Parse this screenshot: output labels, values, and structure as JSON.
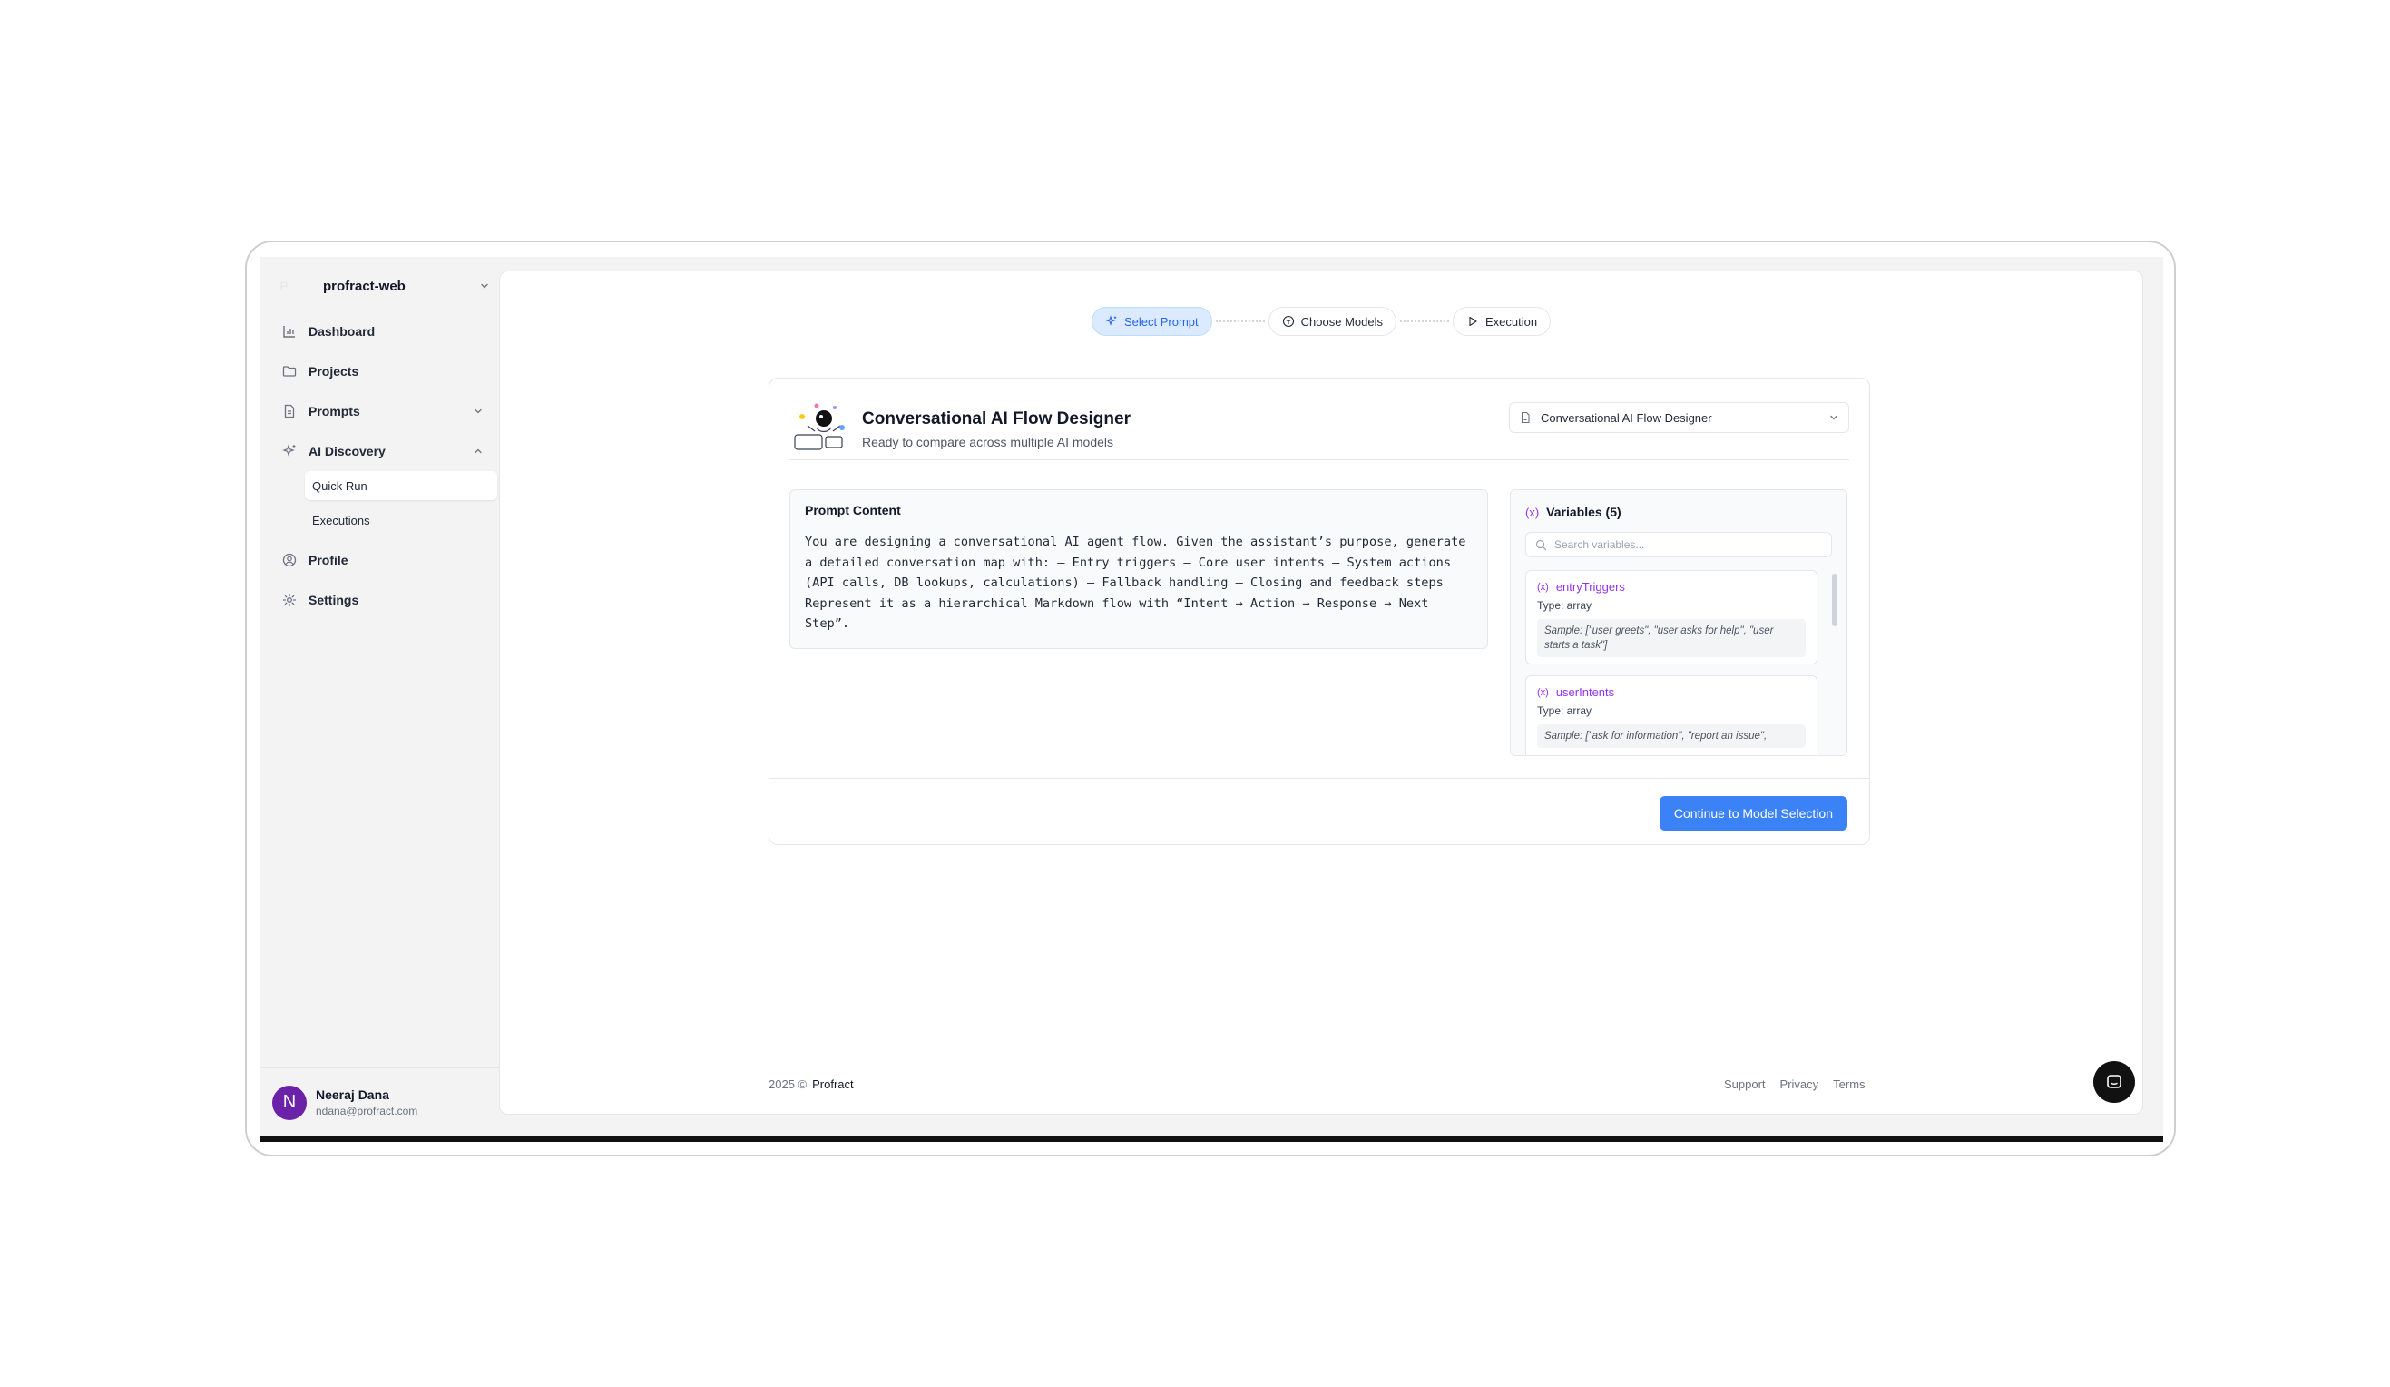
{
  "workspace": {
    "logo": "P",
    "name": "profract-web"
  },
  "nav": {
    "dashboard": "Dashboard",
    "projects": "Projects",
    "prompts": "Prompts",
    "ai_discovery": "AI Discovery",
    "quick_run": "Quick Run",
    "executions": "Executions",
    "profile": "Profile",
    "settings": "Settings"
  },
  "user": {
    "initial": "N",
    "name": "Neeraj Dana",
    "email": "ndana@profract.com"
  },
  "steps": [
    {
      "label": "Select Prompt",
      "state": "active"
    },
    {
      "label": "Choose Models",
      "state": "pending"
    },
    {
      "label": "Execution",
      "state": "pending"
    }
  ],
  "prompt": {
    "title": "Conversational AI Flow Designer",
    "subtitle": "Ready to compare across multiple AI models",
    "selected": "Conversational AI Flow Designer",
    "content_title": "Prompt Content",
    "content": "You are designing a conversational AI agent flow. Given the assistant’s purpose, generate\na detailed conversation map with: – Entry triggers – Core user intents – System actions\n(API calls, DB lookups, calculations) – Fallback handling – Closing and feedback steps\nRepresent it as a hierarchical Markdown flow with “Intent → Action → Response → Next\nStep”."
  },
  "variables": {
    "heading": "Variables (5)",
    "search_placeholder": "Search variables...",
    "items": [
      {
        "name": "entryTriggers",
        "type": "Type: array",
        "sample": "Sample: [\"user greets\", \"user asks for help\", \"user starts a task\"]"
      },
      {
        "name": "userIntents",
        "type": "Type: array",
        "sample": "Sample: [\"ask for information\", \"report an issue\","
      }
    ]
  },
  "continue_label": "Continue to Model Selection",
  "footer": {
    "copyright": "2025 ©",
    "brand": "Profract",
    "support": "Support",
    "privacy": "Privacy",
    "terms": "Terms"
  },
  "colors": {
    "accent": "#3b82f6",
    "variable": "#9333ea",
    "avatar": "#6b21a8"
  }
}
